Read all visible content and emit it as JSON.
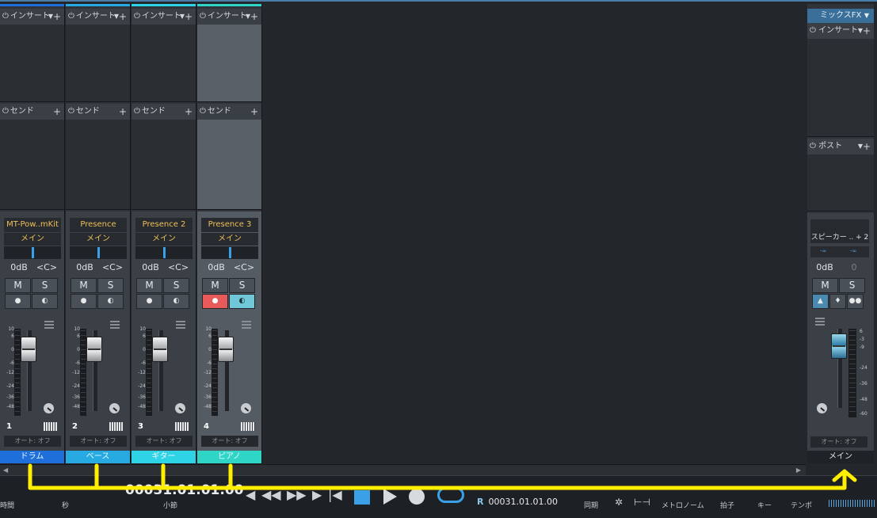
{
  "channels": [
    {
      "insert_label": "インサート",
      "send_label": "センド",
      "name": "MT-Pow..mKit",
      "route": "メイン",
      "volume": "0dB",
      "pan": "<C>",
      "mute": "M",
      "solo": "S",
      "number": "1",
      "automation": "オート: オフ",
      "label": "ドラム",
      "color": "#1e6fd9",
      "selected": false,
      "record_on": false,
      "monitor_on": false
    },
    {
      "insert_label": "インサート",
      "send_label": "センド",
      "name": "Presence",
      "route": "メイン",
      "volume": "0dB",
      "pan": "<C>",
      "mute": "M",
      "solo": "S",
      "number": "2",
      "automation": "オート: オフ",
      "label": "ベース",
      "color": "#27a9e1",
      "selected": false,
      "record_on": false,
      "monitor_on": false
    },
    {
      "insert_label": "インサート",
      "send_label": "センド",
      "name": "Presence 2",
      "route": "メイン",
      "volume": "0dB",
      "pan": "<C>",
      "mute": "M",
      "solo": "S",
      "number": "3",
      "automation": "オート: オフ",
      "label": "ギター",
      "color": "#2fd3e6",
      "selected": false,
      "record_on": false,
      "monitor_on": false
    },
    {
      "insert_label": "インサート",
      "send_label": "センド",
      "name": "Presence 3",
      "route": "メイン",
      "volume": "0dB",
      "pan": "<C>",
      "mute": "M",
      "solo": "S",
      "number": "4",
      "automation": "オート: オフ",
      "label": "ピアノ",
      "color": "#2fd6c8",
      "selected": true,
      "record_on": true,
      "monitor_on": true
    }
  ],
  "fader_scale": [
    "10",
    "6",
    "0",
    "-6",
    "-12",
    "-24",
    "-36",
    "-48"
  ],
  "main_bus": {
    "mix_label": "ミックスFX",
    "insert_label": "インサート",
    "post_label": "ポスト",
    "output": "スピーカー .. + 2",
    "left_value": "-∞",
    "right_value": "-∞",
    "volume": "0dB",
    "pan": "0",
    "mute": "M",
    "solo": "S",
    "scale": [
      "6",
      "-3",
      "-9",
      "-24",
      "-36",
      "-48",
      "-60"
    ],
    "automation": "オート: オフ",
    "label": "メイン"
  },
  "transport": {
    "time_label": "時間",
    "seconds_label": "秒",
    "position": "00031.01.01.00",
    "bars_label": "小節",
    "right_locator": "00031.01.01.00",
    "right_marker": "R",
    "sync_label": "同期",
    "metronome_label": "メトロノーム",
    "signature_label": "拍子",
    "key_label": "キー",
    "tempo_label": "テンポ"
  }
}
